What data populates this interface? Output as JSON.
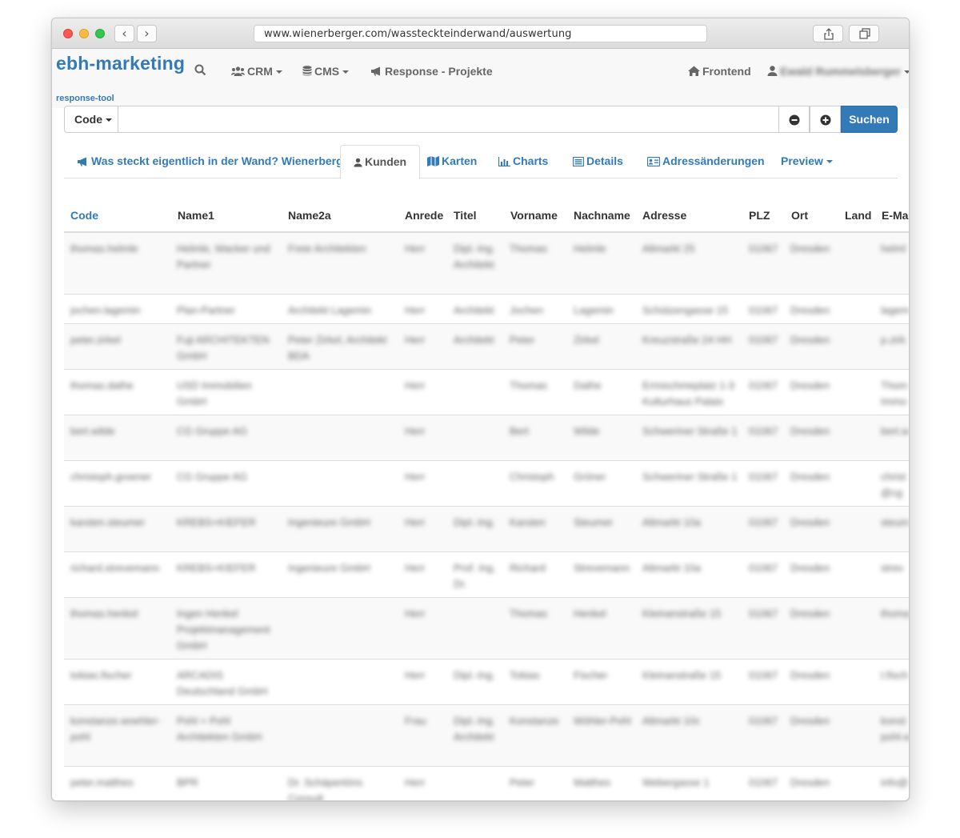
{
  "browser": {
    "url": "www.wienerberger.com/wassteckteinderwand/auswertung",
    "back_glyph": "‹",
    "forward_glyph": "›"
  },
  "nav": {
    "brand": "ebh-marketing",
    "brand_sub": "response-tool",
    "crm": "CRM",
    "cms": "CMS",
    "response": "Response - Projekte",
    "frontend": "Frontend",
    "user": "Ewald Rummelsberger"
  },
  "search": {
    "code_label": "Code",
    "submit_label": "Suchen",
    "placeholder": ""
  },
  "tabs": {
    "project": "Was steckt eigentlich in der Wand? Wienerberger",
    "kunden": "Kunden",
    "karten": "Karten",
    "charts": "Charts",
    "details": "Details",
    "adress": "Adressänderungen",
    "preview": "Preview"
  },
  "table": {
    "headers": [
      "Code",
      "Name1",
      "Name2a",
      "Anrede",
      "Titel",
      "Vorname",
      "Nachname",
      "Adresse",
      "PLZ",
      "Ort",
      "Land",
      "E-Mai"
    ],
    "rows": [
      [
        "thomas.helmle",
        "Helmle, Wacker und Partner",
        "Freie Architekten",
        "Herr",
        "Dipl.-Ing. Architekt",
        "Thomas",
        "Helmle",
        "Altmarkt 25",
        "01067",
        "Dresden",
        "",
        "helml"
      ],
      [
        "jochen.lagemin",
        "Plan-Partner",
        "Architekt Lagemin",
        "Herr",
        "Architekt",
        "Jochen",
        "Lagemin",
        "Schützengasse 15",
        "01067",
        "Dresden",
        "",
        "lagem"
      ],
      [
        "peter.zirkel",
        "Fuji ARCHITEKTEN GmbH",
        "Peter Zirkel, Architekt BDA",
        "Herr",
        "Architekt",
        "Peter",
        "Zirkel",
        "Kreuzstraße 24 HH",
        "01067",
        "Dresden",
        "",
        "p.zirk"
      ],
      [
        "thomas.dathe",
        "USD Immobilien GmbH",
        "",
        "Herr",
        "",
        "Thomas",
        "Dathe",
        "Ermischmeplatz 1-3 Kulturhaus Palais",
        "01067",
        "Dresden",
        "",
        "Thom Immo"
      ],
      [
        "bert.wilde",
        "CG Gruppe AG",
        "",
        "Herr",
        "",
        "Bert",
        "Wilde",
        "Schweriner Straße 1",
        "01067",
        "Dresden",
        "",
        "bert.w"
      ],
      [
        "christoph.groener",
        "CG Gruppe AG",
        "",
        "Herr",
        "",
        "Christoph",
        "Gröner",
        "Schweriner Straße 1",
        "01067",
        "Dresden",
        "",
        "christ @cg"
      ],
      [
        "karsten.steumer",
        "KREBS+KIEFER",
        "Ingenieure GmbH",
        "Herr",
        "Dipl.-Ing.",
        "Karsten",
        "Steumer",
        "Altmarkt 10a",
        "01067",
        "Dresden",
        "",
        "steum"
      ],
      [
        "richard.strevemann",
        "KREBS+KIEFER",
        "Ingenieure GmbH",
        "Herr",
        "Prof. Ing. Dr.",
        "Richard",
        "Strevemann",
        "Altmarkt 10a",
        "01067",
        "Dresden",
        "",
        "strev"
      ],
      [
        "thomas.henkel",
        "Ingen Henkel Projektmanagement GmbH",
        "",
        "Herr",
        "",
        "Thomas",
        "Henkel",
        "Kleinanstraße 15",
        "01067",
        "Dresden",
        "",
        "thoma"
      ],
      [
        "tobias.fischer",
        "ARCADIS Deutschland GmbH",
        "",
        "Herr",
        "Dipl.-Ing.",
        "Tobias",
        "Fischer",
        "Kleinanstraße 15",
        "01067",
        "Dresden",
        "",
        "t.fisch"
      ],
      [
        "konstanze.woehler-pohl",
        "Pohl + Pohl Architekten GmbH",
        "",
        "Frau",
        "Dipl.-Ing. Architekt",
        "Konstanze",
        "Wöhler-Pohl",
        "Altmarkt 10c",
        "01067",
        "Dresden",
        "",
        "konst pohl-a"
      ],
      [
        "peter.matthes",
        "BPR",
        "Dr. Schäpertöns Consult",
        "Herr",
        "",
        "Peter",
        "Matthes",
        "Webergasse 1",
        "01067",
        "Dresden",
        "",
        "info@"
      ]
    ]
  }
}
